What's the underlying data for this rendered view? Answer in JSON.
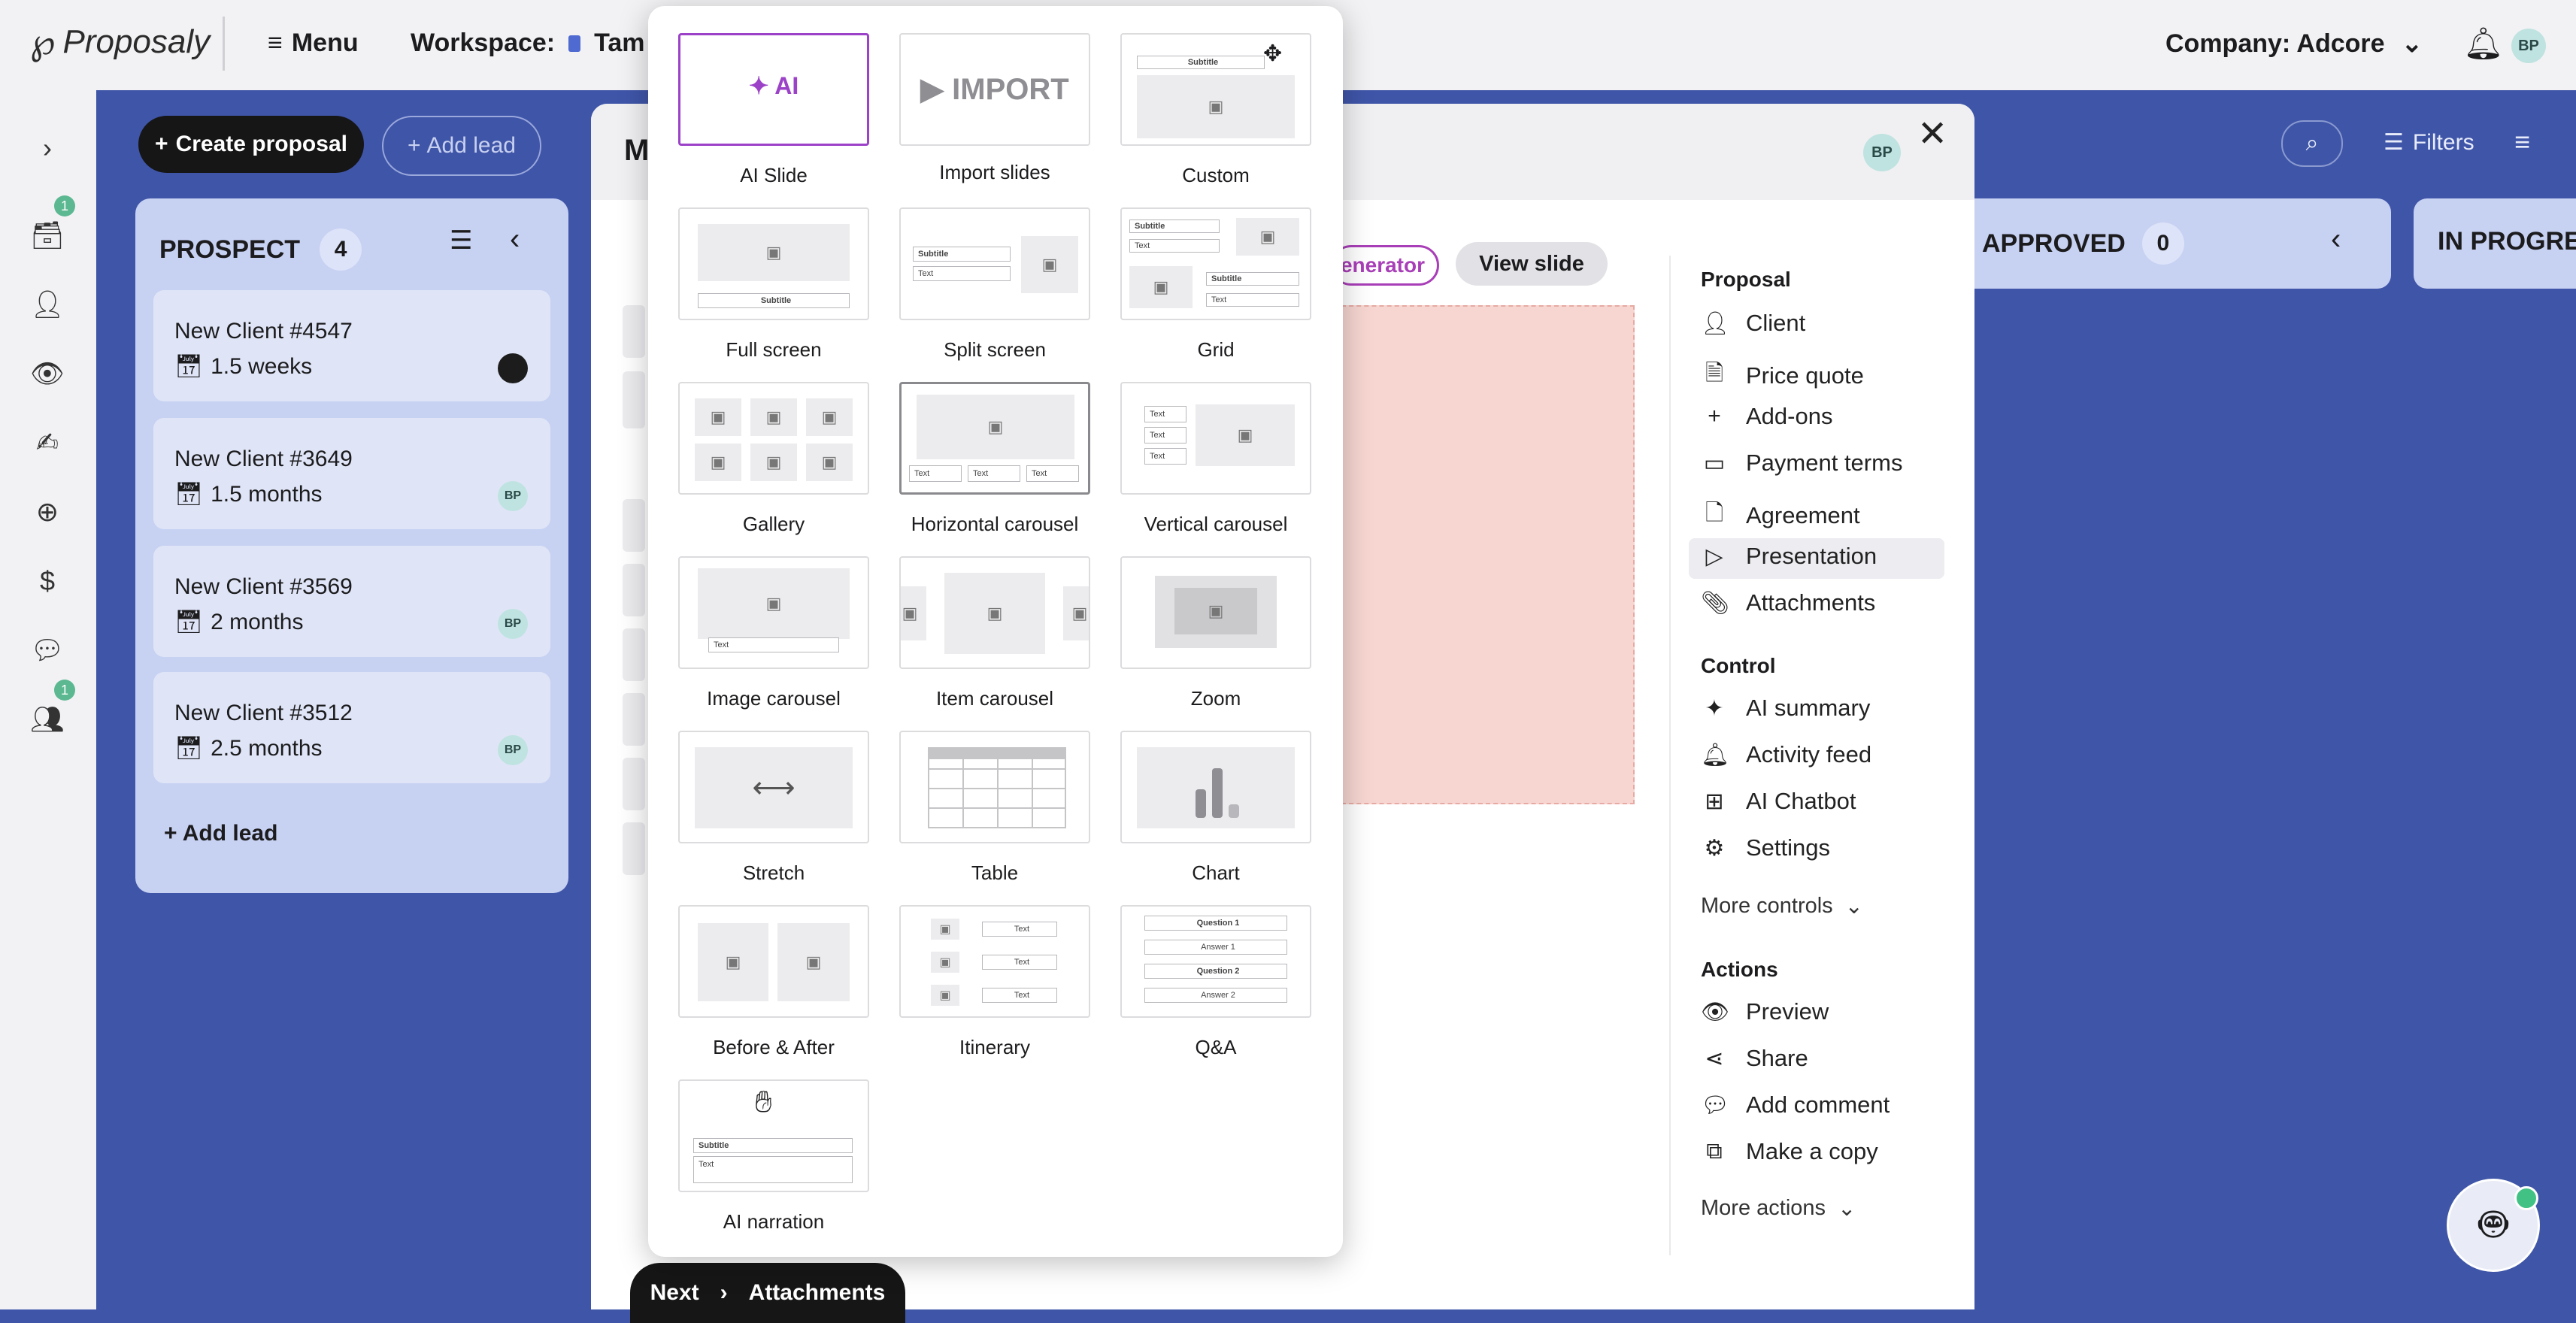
{
  "app": {
    "logo": "Proposaly",
    "menu_label": "Menu",
    "workspace_label": "Workspace:",
    "workspace_value": "Tam",
    "company_label": "Company: Adcore",
    "avatar": "BP"
  },
  "rail": {
    "badges": [
      "1",
      "1"
    ]
  },
  "board": {
    "create_label": "Create proposal",
    "add_lead_label": "Add lead",
    "search_icon": "search-icon",
    "filters_label": "Filters",
    "columns": [
      {
        "name": "PROSPECT",
        "count": "4"
      },
      {
        "name": "APPROVED",
        "count": "0"
      },
      {
        "name": "IN PROGRE"
      }
    ],
    "cards": [
      {
        "title": "New Client #4547",
        "due": "1.5 weeks",
        "avatar": ""
      },
      {
        "title": "New Client #3649",
        "due": "1.5 months",
        "avatar": "BP"
      },
      {
        "title": "New Client #3569",
        "due": "2 months",
        "avatar": "BP"
      },
      {
        "title": "New Client #3512",
        "due": "2.5 months",
        "avatar": "BP"
      }
    ],
    "add_lead_col": "+ Add lead"
  },
  "modal": {
    "title_fragment": "M",
    "avatar": "BP",
    "generator_fragment": "enerator",
    "view_slide": "View slide",
    "sections": [
      {
        "title": "Proposal",
        "items": [
          {
            "label": "Client",
            "icon": "user-icon"
          },
          {
            "label": "Price quote",
            "icon": "document-icon"
          },
          {
            "label": "Add-ons",
            "icon": "plus-icon"
          },
          {
            "label": "Payment terms",
            "icon": "card-icon"
          },
          {
            "label": "Agreement",
            "icon": "signed-doc-icon"
          },
          {
            "label": "Presentation",
            "icon": "play-icon",
            "active": true
          },
          {
            "label": "Attachments",
            "icon": "paperclip-icon"
          }
        ]
      },
      {
        "title": "Control",
        "items": [
          {
            "label": "AI summary",
            "icon": "sparkle-icon"
          },
          {
            "label": "Activity feed",
            "icon": "bell-icon"
          },
          {
            "label": "AI Chatbot",
            "icon": "chip-icon"
          },
          {
            "label": "Settings",
            "icon": "gear-icon"
          }
        ],
        "more": "More controls"
      },
      {
        "title": "Actions",
        "items": [
          {
            "label": "Preview",
            "icon": "eye-icon"
          },
          {
            "label": "Share",
            "icon": "share-icon"
          },
          {
            "label": "Add comment",
            "icon": "comment-icon"
          },
          {
            "label": "Make a copy",
            "icon": "copy-icon"
          }
        ],
        "more": "More actions"
      }
    ],
    "next_label": "Next",
    "next_target": "Attachments"
  },
  "layouts": {
    "items": [
      {
        "label": "AI Slide",
        "preview": "AI"
      },
      {
        "label": "Import slides",
        "preview": "IMPORT"
      },
      {
        "label": "Custom",
        "preview": "Subtitle"
      },
      {
        "label": "Full screen",
        "preview": "Subtitle"
      },
      {
        "label": "Split screen",
        "preview": [
          "Subtitle",
          "Text"
        ]
      },
      {
        "label": "Grid",
        "preview": [
          "Subtitle",
          "Text",
          "Subtitle",
          "Text"
        ]
      },
      {
        "label": "Gallery"
      },
      {
        "label": "Horizontal carousel",
        "preview": [
          "Text",
          "Text",
          "Text"
        ]
      },
      {
        "label": "Vertical carousel",
        "preview": [
          "Text",
          "Text",
          "Text"
        ]
      },
      {
        "label": "Image carousel",
        "preview": "Text"
      },
      {
        "label": "Item carousel"
      },
      {
        "label": "Zoom"
      },
      {
        "label": "Stretch"
      },
      {
        "label": "Table"
      },
      {
        "label": "Chart"
      },
      {
        "label": "Before & After"
      },
      {
        "label": "Itinerary",
        "preview": [
          "Text",
          "Text",
          "Text"
        ]
      },
      {
        "label": "Q&A",
        "preview": [
          "Question 1",
          "Answer 1",
          "Question 2",
          "Answer 2"
        ]
      },
      {
        "label": "AI narration",
        "preview": [
          "Subtitle",
          "Text"
        ]
      }
    ]
  }
}
